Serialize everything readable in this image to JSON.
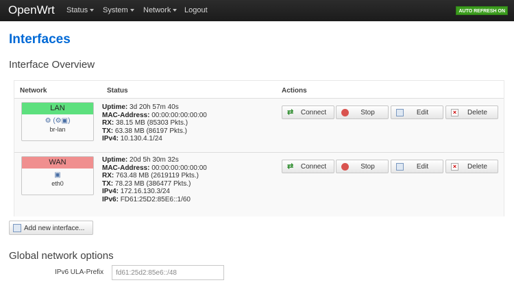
{
  "nav": {
    "brand": "OpenWrt",
    "items": [
      {
        "label": "Status"
      },
      {
        "label": "System"
      },
      {
        "label": "Network"
      },
      {
        "label": "Logout"
      }
    ],
    "refresh": "AUTO REFRESH ON"
  },
  "page": {
    "title": "Interfaces",
    "overview_title": "Interface Overview",
    "global_title": "Global network options"
  },
  "table": {
    "headers": {
      "network": "Network",
      "status": "Status",
      "actions": "Actions"
    },
    "rows": [
      {
        "name": "LAN",
        "color": "#5de07e",
        "device": "br-lan",
        "uptime_label": "Uptime:",
        "uptime": "3d 20h 57m 40s",
        "mac_label": "MAC-Address:",
        "mac": "00:00:00:00:00:00",
        "rx_label": "RX:",
        "rx": "38.15 MB (85303 Pkts.)",
        "tx_label": "TX:",
        "tx": "63.38 MB (86197 Pkts.)",
        "ipv4_label": "IPv4:",
        "ipv4": "10.130.4.1/24"
      },
      {
        "name": "WAN",
        "color": "#f08f8f",
        "device": "eth0",
        "uptime_label": "Uptime:",
        "uptime": "20d 5h 30m 32s",
        "mac_label": "MAC-Address:",
        "mac": "00:00:00:00:00:00",
        "rx_label": "RX:",
        "rx": "763.48 MB (2619119 Pkts.)",
        "tx_label": "TX:",
        "tx": "78.23 MB (386477 Pkts.)",
        "ipv4_label": "IPv4:",
        "ipv4": "172.16.130.3/24",
        "ipv6_label": "IPv6:",
        "ipv6": "FD61:25D2:85E6::1/60"
      }
    ],
    "actions": {
      "connect": "Connect",
      "stop": "Stop",
      "edit": "Edit",
      "delete": "Delete"
    }
  },
  "add_interface": "Add new interface...",
  "ula": {
    "label": "IPv6 ULA-Prefix",
    "value": "fd61:25d2:85e6::/48"
  }
}
